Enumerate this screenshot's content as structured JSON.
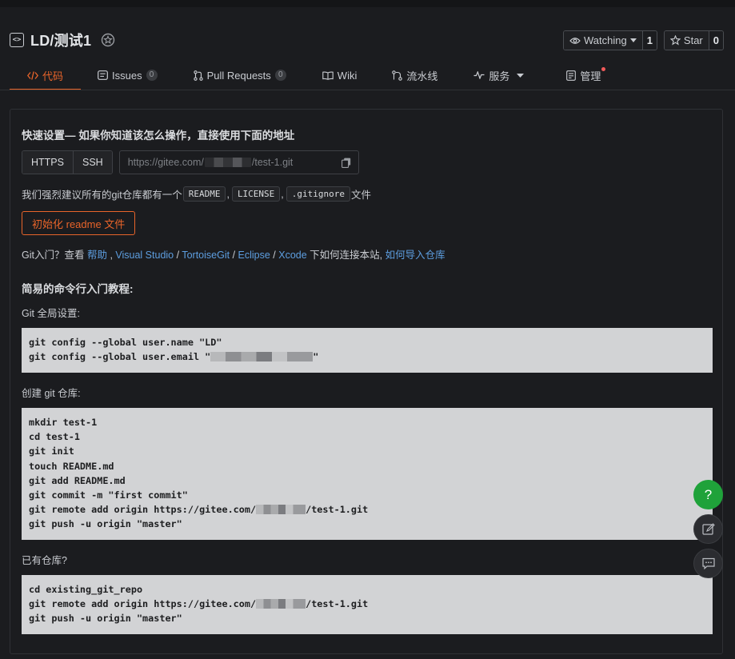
{
  "repo": {
    "title": "LD/测试1"
  },
  "actions": {
    "watch_label": "Watching",
    "watch_count": "1",
    "star_label": "Star",
    "star_count": "0"
  },
  "tabs": [
    {
      "label": "代码",
      "icon": "code-icon",
      "active": true
    },
    {
      "label": "Issues",
      "count": "0",
      "icon": "issues-icon"
    },
    {
      "label": "Pull Requests",
      "count": "0",
      "icon": "pull-request-icon"
    },
    {
      "label": "Wiki",
      "icon": "book-icon"
    },
    {
      "label": "流水线",
      "icon": "pipeline-icon"
    },
    {
      "label": "服务",
      "icon": "pulse-icon"
    },
    {
      "label": "管理",
      "icon": "settings-icon"
    }
  ],
  "quick_setup": {
    "title": "快速设置— 如果你知道该怎么操作，直接使用下面的地址",
    "https_label": "HTTPS",
    "ssh_label": "SSH",
    "url_prefix": "https://gitee.com/",
    "url_suffix": "/test-1.git"
  },
  "recommend": {
    "prefix": "我们强烈建议所有的git仓库都有一个",
    "readme": "README",
    "license": "LICENSE",
    "gitignore": ".gitignore",
    "suffix": "文件"
  },
  "init_button": "初始化 readme 文件",
  "help": {
    "prefix": "Git入门？查看 ",
    "help_link": "帮助",
    "vs_link": "Visual Studio",
    "tortoise_link": "TortoiseGit",
    "eclipse_link": "Eclipse",
    "xcode_link": "Xcode",
    "middle": " 下如何连接本站, ",
    "import_link": "如何导入仓库"
  },
  "tutorial_title": "简易的命令行入门教程:",
  "global_label": "Git 全局设置:",
  "global_code": [
    "git config --global user.name \"LD\"",
    "git config --global user.email \""
  ],
  "global_code_end": "\"",
  "create_label": "创建 git 仓库:",
  "create_code": [
    "mkdir test-1",
    "cd test-1",
    "git init",
    "touch README.md",
    "git add README.md",
    "git commit -m \"first commit\""
  ],
  "create_remote_prefix": "git remote add origin https://gitee.com/",
  "create_remote_suffix": "/test-1.git",
  "create_push": "git push -u origin \"master\"",
  "existing_label": "已有仓库?",
  "existing_cd": "cd existing_git_repo",
  "existing_remote_prefix": "git remote add origin https://gitee.com/",
  "existing_remote_suffix": "/test-1.git",
  "existing_push": "git push -u origin \"master\"",
  "float_help": "?",
  "colors": {
    "accent": "#e8642a",
    "link": "#5d9ee0",
    "help_green": "#1fa23a"
  }
}
